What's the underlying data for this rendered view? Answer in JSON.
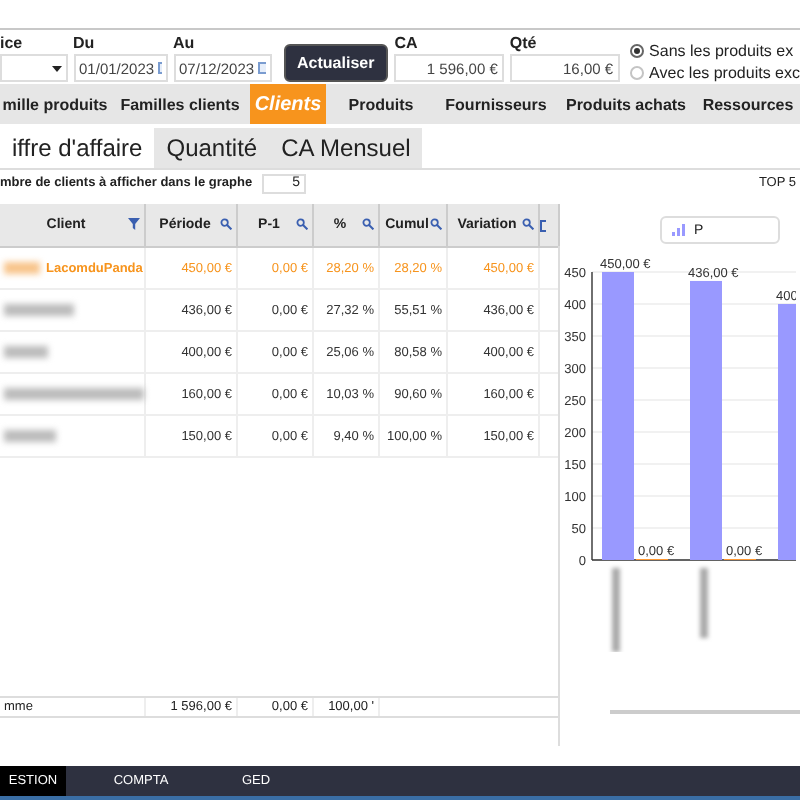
{
  "filters": {
    "dropdown_label": "ice",
    "from_label": "Du",
    "from_value": "01/01/2023",
    "to_label": "Au",
    "to_value": "07/12/2023",
    "refresh_button": "Actualiser",
    "ca_label": "CA",
    "ca_value": "1 596,00 €",
    "qty_label": "Qté",
    "qty_value": "16,00 €",
    "options": [
      {
        "label": "Sans les produits ex",
        "selected": true
      },
      {
        "label": "Avec les produits exc",
        "selected": false
      }
    ]
  },
  "tabs": [
    {
      "label": "mille produits",
      "selected": false
    },
    {
      "label": "Familles clients",
      "selected": false
    },
    {
      "label": "Clients",
      "selected": true
    },
    {
      "label": "Produits",
      "selected": false
    },
    {
      "label": "Fournisseurs",
      "selected": false
    },
    {
      "label": "Produits achats",
      "selected": false
    },
    {
      "label": "Ressources",
      "selected": false
    }
  ],
  "subtabs": [
    {
      "label": "iffre d'affaire",
      "selected": true
    },
    {
      "label": "Quantité",
      "selected": false
    },
    {
      "label": "CA Mensuel",
      "selected": false
    }
  ],
  "count_label": "mbre de clients à afficher dans le graphe",
  "count_value": "5",
  "top_label": "TOP 5",
  "table": {
    "columns": [
      "Client",
      "Période",
      "P-1",
      "%",
      "Cumul",
      "Variation"
    ],
    "rows": [
      {
        "highlighted": true,
        "cells": [
          "LacomduPanda",
          "450,00 €",
          "0,00 €",
          "28,20 %",
          "28,20 %",
          "450,00 €"
        ]
      },
      {
        "highlighted": false,
        "cells": [
          "",
          "436,00 €",
          "0,00 €",
          "27,32 %",
          "55,51 %",
          "436,00 €"
        ]
      },
      {
        "highlighted": false,
        "cells": [
          "",
          "400,00 €",
          "0,00 €",
          "25,06 %",
          "80,58 %",
          "400,00 €"
        ]
      },
      {
        "highlighted": false,
        "cells": [
          "",
          "160,00 €",
          "0,00 €",
          "10,03 %",
          "90,60 %",
          "160,00 €"
        ]
      },
      {
        "highlighted": false,
        "cells": [
          "",
          "150,00 €",
          "0,00 €",
          "9,40 %",
          "100,00 %",
          "150,00 €"
        ]
      }
    ],
    "total": [
      "mme",
      "1 596,00 €",
      "0,00 €",
      "100,00 '"
    ]
  },
  "chart_data": {
    "type": "bar",
    "grid": true,
    "ylim": [
      0,
      450
    ],
    "yticks": [
      0,
      50,
      100,
      150,
      200,
      250,
      300,
      350,
      400,
      450
    ],
    "series": [
      {
        "name": "P",
        "color": "#9999ff",
        "values": [
          450,
          436,
          400
        ]
      },
      {
        "color": "#ff9933",
        "values": [
          0,
          0,
          null
        ]
      }
    ],
    "value_labels": [
      [
        "450,00 €",
        "436,00 €",
        "400"
      ],
      [
        "0,00 €",
        "0,00 €",
        null
      ]
    ]
  },
  "bottom_tabs": [
    {
      "label": "ESTION",
      "selected": true
    },
    {
      "label": "COMPTA",
      "selected": false
    },
    {
      "label": "GED",
      "selected": false
    }
  ]
}
